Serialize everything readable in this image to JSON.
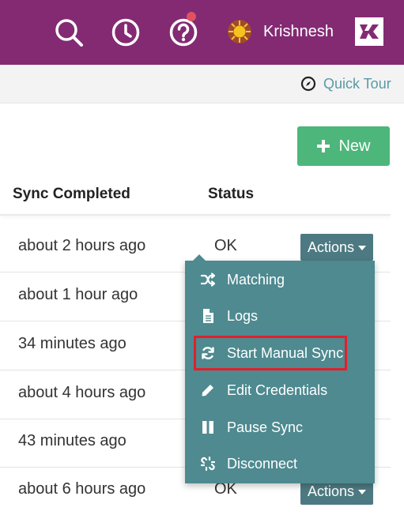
{
  "header": {
    "username": "Krishnesh",
    "colors": {
      "bar": "#832a73",
      "notification": "#e05262"
    },
    "icons": [
      "search-icon",
      "history-clock-icon",
      "help-icon",
      "avatar-sun-icon",
      "brand-logo-icon"
    ]
  },
  "subbar": {
    "quick_tour_label": "Quick Tour",
    "quick_tour_icon": "compass-icon"
  },
  "new_button": {
    "label": "New",
    "color": "#4db67a"
  },
  "table": {
    "columns": [
      "Sync Completed",
      "Status"
    ],
    "rows": [
      {
        "time": "about 2 hours ago",
        "status": "OK",
        "actions": "Actions"
      },
      {
        "time": "about 1 hour ago",
        "status": "",
        "actions": ""
      },
      {
        "time": "34 minutes ago",
        "status": "",
        "actions": ""
      },
      {
        "time": "about 4 hours ago",
        "status": "",
        "actions": ""
      },
      {
        "time": "43 minutes ago",
        "status": "",
        "actions": ""
      },
      {
        "time": "about 6 hours ago",
        "status": "OK",
        "actions": "Actions"
      }
    ]
  },
  "actions_menu": {
    "items": [
      {
        "label": "Matching",
        "icon": "shuffle-icon"
      },
      {
        "label": "Logs",
        "icon": "document-icon"
      },
      {
        "label": "Start Manual Sync",
        "icon": "refresh-icon",
        "highlighted": true
      },
      {
        "label": "Edit Credentials",
        "icon": "pencil-icon"
      },
      {
        "label": "Pause Sync",
        "icon": "pause-icon"
      },
      {
        "label": "Disconnect",
        "icon": "unlink-icon"
      }
    ],
    "color": "#4e8a90",
    "highlight_color": "#e0202c"
  }
}
